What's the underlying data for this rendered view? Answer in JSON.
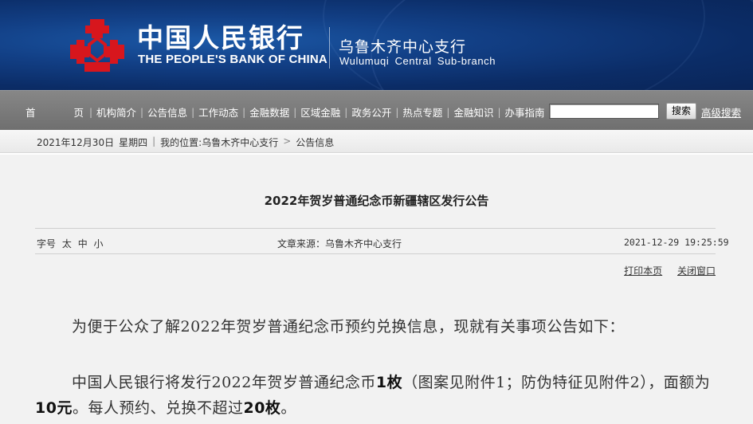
{
  "header": {
    "brand_cn": "中国人民银行",
    "brand_en": "THE PEOPLE'S BANK OF CHINA",
    "branch_cn": "乌鲁木齐中心支行",
    "branch_en": "Wulumuqi Central Sub-branch",
    "logo_color": "#d7161d",
    "banner_color": "#123f85"
  },
  "nav": {
    "items": [
      "首 页",
      "机构简介",
      "公告信息",
      "工作动态",
      "金融数据",
      "区域金融",
      "政务公开",
      "热点专题",
      "金融知识",
      "办事指南"
    ],
    "search_value": "",
    "search_button": "搜索",
    "advanced_search": "高级搜索"
  },
  "crumb": {
    "date": "2021年12月30日",
    "weekday": "星期四",
    "location_label": "我的位置:",
    "location_branch": "乌鲁木齐中心支行",
    "location_section": "公告信息"
  },
  "article": {
    "title": "2022年贺岁普通纪念币新疆辖区发行公告",
    "fontsize_label": "字号",
    "fontsize_options": [
      "太",
      "中",
      "小"
    ],
    "source": "文章来源：乌鲁木齐中心支行",
    "pubtime": "2021-12-29 19:25:59",
    "print_label": "打印本页",
    "close_label": "关闭窗口",
    "p1": "为便于公众了解2022年贺岁普通纪念币预约兑换信息，现就有关事项公告如下：",
    "p2": {
      "a": "中国人民银行将发行2022年贺岁普通纪念币",
      "b": "1枚",
      "c": "（图案见附件1；防伪特征见附件2），面额为",
      "d": "10元",
      "e": "。每人预约、兑换不超过",
      "f": "20枚",
      "g": "。"
    }
  }
}
